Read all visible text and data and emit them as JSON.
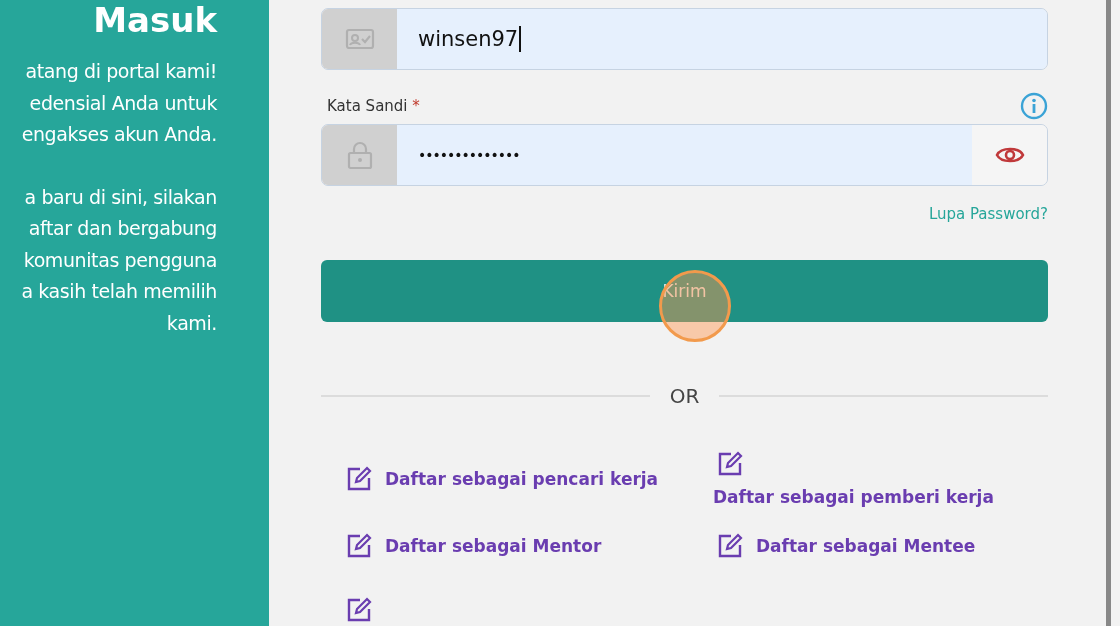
{
  "side_panel": {
    "title": "Masuk",
    "paragraphs": [
      [
        "atang di portal kami!",
        "edensial Anda untuk",
        "engakses akun Anda."
      ],
      [
        "a baru di sini, silakan",
        "aftar dan bergabung",
        "komunitas pengguna",
        "a kasih telah memilih",
        "kami."
      ]
    ]
  },
  "form": {
    "username": {
      "value": "winsen97"
    },
    "password": {
      "label": "Kata Sandi",
      "required_mark": "*",
      "value": "••••••••••••••"
    },
    "forgot_link": "Lupa Password?",
    "submit": "Kirim",
    "divider": "OR",
    "signup_links": [
      {
        "label": "Daftar sebagai pencari kerja",
        "kind": "inline"
      },
      {
        "label": "Daftar sebagai pemberi kerja",
        "kind": "stacked"
      },
      {
        "label": "Daftar sebagai Mentor",
        "kind": "inline"
      },
      {
        "label": "Daftar sebagai Mentee",
        "kind": "inline"
      }
    ]
  }
}
